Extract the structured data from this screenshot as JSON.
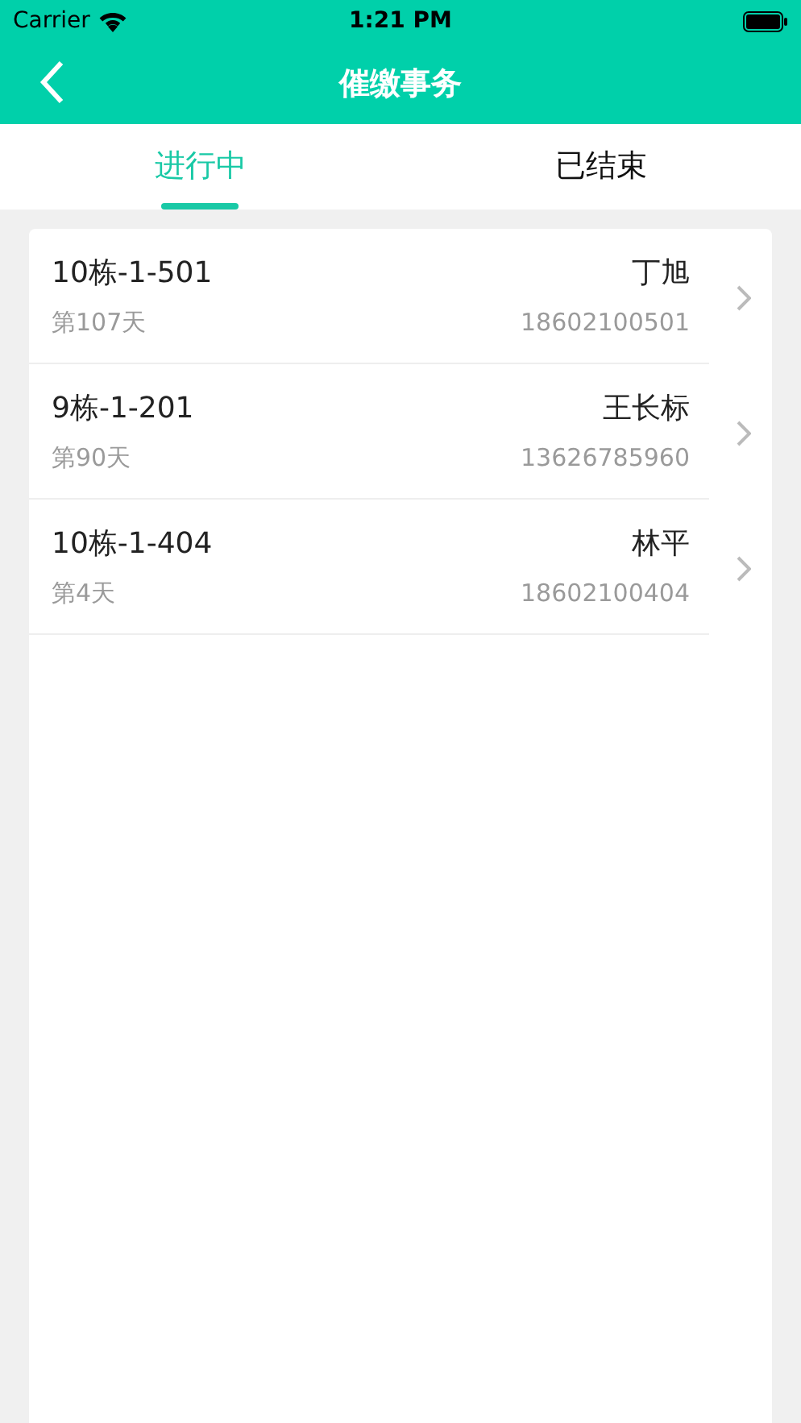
{
  "status_bar": {
    "carrier": "Carrier",
    "time": "1:21 PM"
  },
  "nav": {
    "title": "催缴事务"
  },
  "tabs": [
    {
      "label": "进行中",
      "selected": true
    },
    {
      "label": "已结束",
      "selected": false
    }
  ],
  "items": [
    {
      "unit": "10栋-1-501",
      "days": "第107天",
      "name": "丁旭",
      "phone": "18602100501"
    },
    {
      "unit": "9栋-1-201",
      "days": "第90天",
      "name": "王长标",
      "phone": "13626785960"
    },
    {
      "unit": "10栋-1-404",
      "days": "第4天",
      "name": "林平",
      "phone": "18602100404"
    }
  ]
}
